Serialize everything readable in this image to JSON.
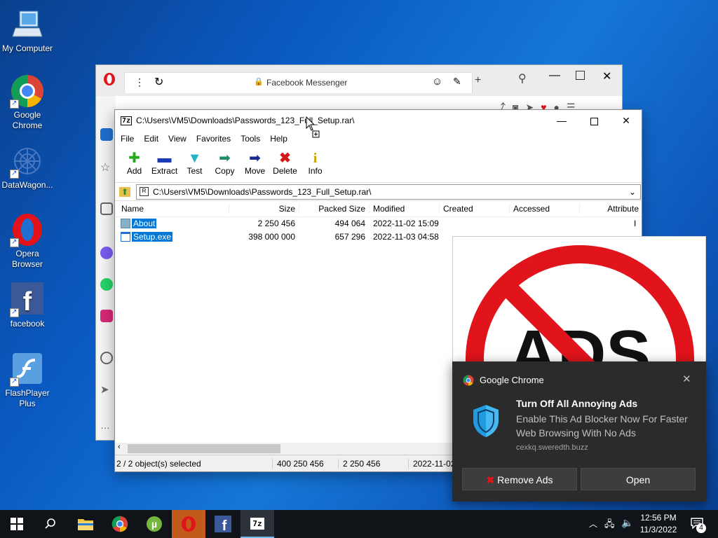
{
  "desktop": {
    "icons": [
      {
        "label": "My Computer",
        "icon": "computer-icon"
      },
      {
        "label": "Google Chrome",
        "icon": "chrome-icon"
      },
      {
        "label": "DataWagon...",
        "icon": "datawagon-icon"
      },
      {
        "label": "Opera Browser",
        "icon": "opera-icon"
      },
      {
        "label": "facebook",
        "icon": "facebook-icon"
      },
      {
        "label": "FlashPlayer Plus",
        "icon": "flash-icon"
      }
    ]
  },
  "browser": {
    "tab_title": "Facebook Messenger"
  },
  "zip": {
    "window_title": "C:\\Users\\VM5\\Downloads\\Passwords_123_Full_Setup.rar\\",
    "menu": [
      "File",
      "Edit",
      "View",
      "Favorites",
      "Tools",
      "Help"
    ],
    "tools": [
      {
        "label": "Add",
        "icon": "add-icon",
        "color": "#22aa22"
      },
      {
        "label": "Extract",
        "icon": "extract-icon",
        "color": "#1a3bb5"
      },
      {
        "label": "Test",
        "icon": "test-icon",
        "color": "#22b5c8"
      },
      {
        "label": "Copy",
        "icon": "copy-icon",
        "color": "#1f8c6a"
      },
      {
        "label": "Move",
        "icon": "move-icon",
        "color": "#1a2a8c"
      },
      {
        "label": "Delete",
        "icon": "delete-icon",
        "color": "#d01818"
      },
      {
        "label": "Info",
        "icon": "info-icon",
        "color": "#c8a800"
      }
    ],
    "path": "C:\\Users\\VM5\\Downloads\\Passwords_123_Full_Setup.rar\\",
    "columns": [
      "Name",
      "Size",
      "Packed Size",
      "Modified",
      "Created",
      "Accessed",
      "Attribute"
    ],
    "rows": [
      {
        "name": "About",
        "size": "2 250 456",
        "packed": "494 064",
        "modified": "2022-11-02 15:09",
        "attr": "I"
      },
      {
        "name": "Setup.exe",
        "size": "398 000 000",
        "packed": "657 296",
        "modified": "2022-11-03 04:58",
        "attr": ""
      }
    ],
    "status": {
      "selected": "2 / 2 object(s) selected",
      "total_size": "400 250 456",
      "packed_size": "2 250 456",
      "date": "2022-11-02"
    }
  },
  "ad_image": {
    "text": "ADS",
    "sign_color": "#e0141a"
  },
  "notification": {
    "app": "Google Chrome",
    "title": "Turn Off All Annoying Ads",
    "body": "Enable This Ad Blocker Now For Faster Web Browsing With No Ads",
    "source": "cexkq.sweredth.buzz",
    "btn_remove": "Remove Ads",
    "btn_open": "Open"
  },
  "taskbar": {
    "time": "12:56 PM",
    "date": "11/3/2022",
    "notif_count": "4",
    "zip_label": "7z"
  }
}
